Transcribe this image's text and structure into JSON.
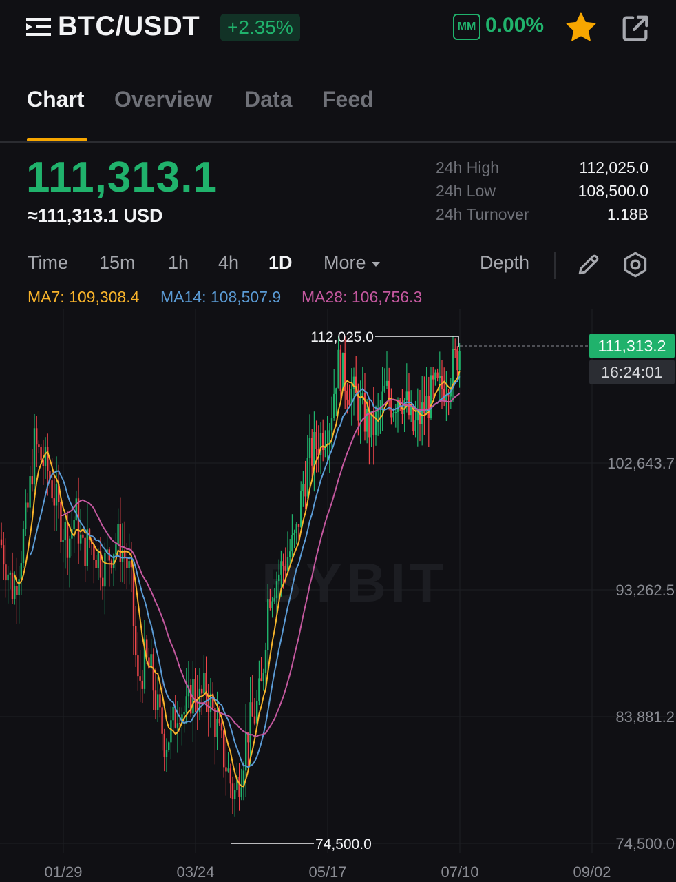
{
  "header": {
    "pair": "BTC/USDT",
    "change_pct": "+2.35%",
    "mm_label": "MM",
    "mm_value": "0.00%",
    "icons": {
      "menu": "list-menu-icon",
      "favorite": "star-icon",
      "share": "external-link-icon"
    }
  },
  "tabs": [
    {
      "label": "Chart",
      "active": true
    },
    {
      "label": "Overview",
      "active": false
    },
    {
      "label": "Data",
      "active": false
    },
    {
      "label": "Feed",
      "active": false
    }
  ],
  "ticker": {
    "last_price": "111,313.1",
    "usd_price": "≈111,313.1 USD",
    "stats": [
      {
        "label": "24h High",
        "value": "112,025.0"
      },
      {
        "label": "24h Low",
        "value": "108,500.0"
      },
      {
        "label": "24h Turnover",
        "value": "1.18B"
      }
    ]
  },
  "timeframes": [
    {
      "label": "Time",
      "active": false
    },
    {
      "label": "15m",
      "active": false
    },
    {
      "label": "1h",
      "active": false
    },
    {
      "label": "4h",
      "active": false
    },
    {
      "label": "1D",
      "active": true
    },
    {
      "label": "More",
      "active": false
    }
  ],
  "toolbar": {
    "depth_label": "Depth",
    "draw_icon": "pencil-icon",
    "settings_icon": "settings-icon"
  },
  "indicators": [
    {
      "label": "MA7: 109,308.4",
      "color": "#f7b32b"
    },
    {
      "label": "MA14: 108,507.9",
      "color": "#5b9bd5"
    },
    {
      "label": "MA28: 106,756.3",
      "color": "#c4589f"
    }
  ],
  "chart_data": {
    "type": "candlestick",
    "y_axis_labels": [
      "102,643.7",
      "93,262.5",
      "83,881.2",
      "74,500.0"
    ],
    "x_axis_labels": [
      "01/29",
      "03/24",
      "05/17",
      "07/10",
      "09/02"
    ],
    "ylim": [
      74500,
      112025
    ],
    "high_marker": "112,025.0",
    "low_marker": "74,500.0",
    "last_price": "111,313.2",
    "countdown": "16:24:01",
    "up_color": "#20b26c",
    "down_color": "#ef454a",
    "close_series_approx": [
      [
        0,
        97000
      ],
      [
        10,
        95000
      ],
      [
        20,
        93000
      ],
      [
        30,
        96000
      ],
      [
        40,
        99000
      ],
      [
        50,
        104000
      ],
      [
        60,
        103000
      ],
      [
        70,
        102000
      ],
      [
        80,
        100000
      ],
      [
        90,
        98000
      ],
      [
        100,
        97000
      ],
      [
        110,
        99000
      ],
      [
        120,
        96000
      ],
      [
        130,
        97000
      ],
      [
        140,
        96000
      ],
      [
        150,
        95000
      ],
      [
        160,
        96000
      ],
      [
        170,
        97000
      ],
      [
        180,
        96000
      ],
      [
        190,
        94000
      ],
      [
        200,
        86000
      ],
      [
        210,
        88000
      ],
      [
        220,
        87000
      ],
      [
        230,
        84000
      ],
      [
        240,
        82000
      ],
      [
        250,
        83000
      ],
      [
        260,
        85000
      ],
      [
        270,
        84000
      ],
      [
        280,
        86000
      ],
      [
        290,
        85000
      ],
      [
        300,
        86000
      ],
      [
        310,
        84000
      ],
      [
        320,
        82000
      ],
      [
        330,
        80000
      ],
      [
        340,
        78000
      ],
      [
        350,
        80000
      ],
      [
        360,
        83000
      ],
      [
        370,
        84000
      ],
      [
        380,
        86000
      ],
      [
        390,
        93000
      ],
      [
        400,
        94000
      ],
      [
        410,
        95000
      ],
      [
        420,
        96000
      ],
      [
        430,
        97000
      ],
      [
        440,
        101000
      ],
      [
        450,
        103000
      ],
      [
        460,
        104000
      ],
      [
        470,
        105000
      ],
      [
        480,
        106000
      ],
      [
        490,
        110000
      ],
      [
        500,
        109000
      ],
      [
        510,
        108000
      ],
      [
        520,
        107000
      ],
      [
        530,
        106000
      ],
      [
        540,
        105000
      ],
      [
        550,
        106000
      ],
      [
        560,
        108000
      ],
      [
        570,
        107000
      ],
      [
        580,
        108000
      ],
      [
        590,
        107000
      ],
      [
        600,
        105000
      ],
      [
        610,
        106000
      ],
      [
        620,
        107000
      ],
      [
        630,
        108000
      ],
      [
        640,
        108000
      ],
      [
        650,
        109000
      ],
      [
        660,
        110000
      ],
      [
        668,
        111313
      ]
    ]
  },
  "watermark": "BYBIT"
}
